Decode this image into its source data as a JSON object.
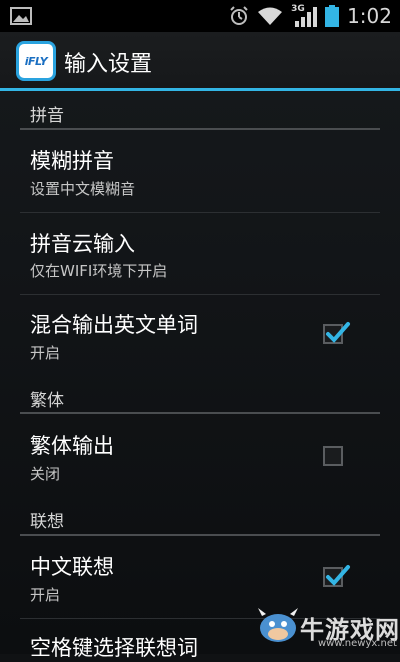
{
  "status_bar": {
    "time": "1:02",
    "network_label": "3G",
    "icons": [
      "image-notification-icon",
      "alarm-clock-icon",
      "wifi-icon",
      "signal-icon",
      "battery-icon"
    ]
  },
  "action_bar": {
    "app_icon_text": "iFLY",
    "title": "输入设置"
  },
  "sections": [
    {
      "header": "拼音",
      "items": [
        {
          "title": "模糊拼音",
          "subtitle": "设置中文模糊音"
        },
        {
          "title": "拼音云输入",
          "subtitle": "仅在WIFI环境下开启"
        },
        {
          "title": "混合输出英文单词",
          "subtitle": "开启",
          "checked": true
        }
      ]
    },
    {
      "header": "繁体",
      "items": [
        {
          "title": "繁体输出",
          "subtitle": "关闭",
          "checked": false
        }
      ]
    },
    {
      "header": "联想",
      "items": [
        {
          "title": "中文联想",
          "subtitle": "开启",
          "checked": true
        },
        {
          "title": "空格键选择联想词",
          "subtitle": ""
        }
      ]
    }
  ],
  "watermark": {
    "text": "牛游戏网",
    "url": "www.newyx.net"
  },
  "colors": {
    "accent": "#33b5e5",
    "background": "#101214",
    "check": "#33b5e5"
  }
}
